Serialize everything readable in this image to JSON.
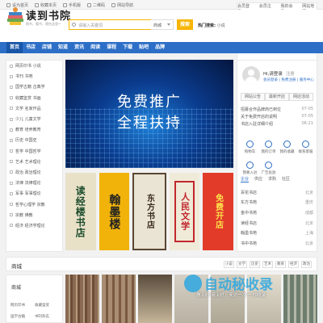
{
  "topbar": {
    "links": [
      "设为首页",
      "收藏本页",
      "手机版",
      "二维码",
      "网站导航"
    ],
    "right": [
      "会员登录",
      "会员注册",
      "我的会员",
      "网站地图"
    ]
  },
  "header": {
    "logo_title": "读到书院",
    "logo_subtitle": "购书、看书，就在这里~",
    "search_placeholder": "请输入关键词",
    "search_select": "商城",
    "search_button": "搜索",
    "hot_label": "热门搜索:",
    "hot_term": "小说"
  },
  "nav": {
    "items": [
      "首页",
      "书店",
      "店铺",
      "知道",
      "资讯",
      "阅读",
      "课程",
      "下载",
      "贴吧",
      "品牌"
    ],
    "active_index": 0
  },
  "sidebar": {
    "items": [
      "网页印书 小说",
      "书刊 书苑",
      "国学古籍 古典学",
      "收藏鉴赏 书画",
      "文学 名家作品",
      "少儿 儿童文学",
      "教育 培养教育",
      "历史 中国史",
      "哲学 中国哲学",
      "艺术 艺术理论",
      "政治 政治理论",
      "法律 法律理论",
      "军事 军事理论",
      "哲学心理学 宗教",
      "宗教 佛教",
      "经济 经济学理论"
    ]
  },
  "banner": {
    "line1": "免费推广",
    "line2": "全程扶持"
  },
  "cards": [
    "读经楼书店",
    "翰墨楼",
    "东方书店",
    "人民文学",
    "免费开店"
  ],
  "user_panel": {
    "greeting": "Hi,请登录",
    "register": "注册",
    "links": "会员登录 | 免费注册 | 服务中心",
    "tabs": [
      "网站公告",
      "最新开店",
      "网店活动"
    ],
    "news": [
      {
        "title": "招募合作品牌商已到位",
        "date": "07-05"
      },
      {
        "title": "关于免费开店的说明",
        "date": "07-05"
      },
      {
        "title": "书店入驻详细介绍",
        "date": "06-21"
      }
    ],
    "icons": [
      "购物车",
      "我的订单",
      "我的收藏",
      "联系客服",
      "我要入驻",
      "广告投放"
    ]
  },
  "right_tabs": {
    "items": [
      "企业",
      "供应",
      "求购",
      "社区"
    ],
    "active_index": 0,
    "list": [
      {
        "name": "百花书店",
        "city": "北京"
      },
      {
        "name": "东方书苑",
        "city": "重庆"
      },
      {
        "name": "金中书苑",
        "city": "成都"
      },
      {
        "name": "读经书店",
        "city": "北京"
      },
      {
        "name": "翰墨书苑",
        "city": "上海"
      },
      {
        "name": "书中书苑",
        "city": "北京"
      }
    ]
  },
  "section": {
    "title": "商城",
    "pills": [
      "小说",
      "文学",
      "历史",
      "艺术",
      "教育",
      "经济",
      "政治"
    ],
    "box_title": "商城",
    "box_links": [
      "网页印书",
      "收藏鉴赏",
      "国学古籍",
      "书刊杂志"
    ]
  },
  "watermark": {
    "main": "自动秘收录",
    "sub": "做上好 用上好，来访一次 一秒收录"
  }
}
